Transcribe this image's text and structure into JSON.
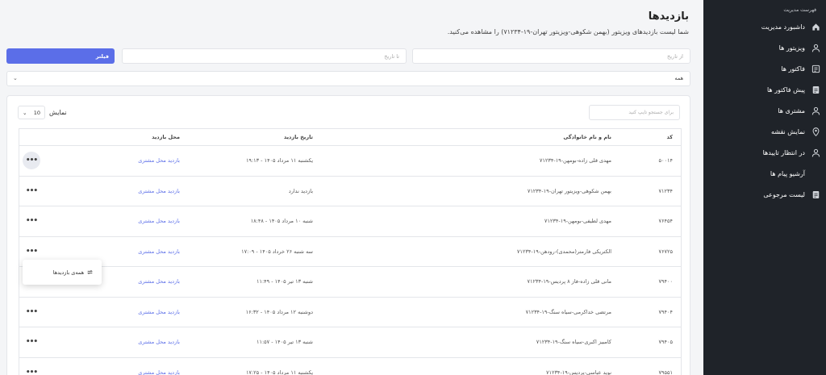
{
  "sidebar": {
    "header": "فهرست مدیریت",
    "items": [
      {
        "label": "داشبورد مدیریت",
        "icon": "home-icon"
      },
      {
        "label": "ویزیتور ها",
        "icon": "user-icon"
      },
      {
        "label": "فاکتور ها",
        "icon": "invoice-icon"
      },
      {
        "label": "پیش فاکتور ها",
        "icon": "document-icon"
      },
      {
        "label": "مشتری ها",
        "icon": "user-icon"
      },
      {
        "label": "نمایش نقشه",
        "icon": "map-pin-icon"
      },
      {
        "label": "در انتظار تاییدها",
        "icon": "user-icon"
      },
      {
        "label": "آرشیو پیام ها",
        "icon": ""
      },
      {
        "label": "لیست مرجوعی",
        "icon": "document-icon"
      }
    ]
  },
  "page": {
    "title": "بازدیدها",
    "subtitle": "شما لیست بازدیدهای ویزیتور (بهمن شکوهی-ویزیتور تهران-۱۹-۷۱۲۳۴) را مشاهده می‌کنید."
  },
  "filters": {
    "from_placeholder": "از تاریخ",
    "to_placeholder": "تا تاریخ",
    "filter_button": "فیلتر",
    "select_value": "همه"
  },
  "table": {
    "show_label": "نمایش",
    "page_size": "10",
    "search_placeholder": "برای جستجو تایپ کنید",
    "columns": [
      "کد",
      "نام و نام خانوادگی",
      "تاریخ بازدید",
      "محل بازدید"
    ],
    "rows": [
      {
        "code": "۵۰۰۱۴",
        "name": "مهدی قلی زاده-بومهن-۱۹-۷۱۲۳۴",
        "date": "یکشنبه ۱۱ مرداد ۱۴۰۵ - ۱۹:۱۳",
        "place": "بازدید محل مشتری"
      },
      {
        "code": "۷۱۲۳۴",
        "name": "بهمن شکوهی-ویزیتور تهران-۱۹-۷۱۲۳۴",
        "date": "بازدید ندارد",
        "place": "بازدید محل مشتری"
      },
      {
        "code": "۷۶۴۵۴",
        "name": "مهدی لطیفی-بومهن-۱۹-۷۱۲۳۴",
        "date": "شنبه ۱۰ مرداد ۱۴۰۵ - ۱۸:۴۸",
        "place": "بازدید محل مشتری"
      },
      {
        "code": "۷۶۷۲۵",
        "name": "الکتریکی فارمتر(محمدی)-رودهن-۱۹-۷۱۲۳۴",
        "date": "سه شنبه ۲۶ خرداد ۱۴۰۵ - ۱۷:۰۹",
        "place": "بازدید محل مشتری"
      },
      {
        "code": "۷۹۴۰۰",
        "name": "مانی قلی زاده-فاز ۸ پردیس-۱۹-۷۱۲۳۴",
        "date": "شنبه ۱۳ تیر ۱۴۰۵ - ۱۱:۴۹",
        "place": "بازدید محل مشتری"
      },
      {
        "code": "۷۹۴۰۴",
        "name": "مرتضی خداکرمی-سیاه سنگ-۱۹-۷۱۲۳۴",
        "date": "دوشنبه ۱۲ مرداد ۱۴۰۵ - ۱۶:۳۲",
        "place": "بازدید محل مشتری"
      },
      {
        "code": "۷۹۴۰۵",
        "name": "کامبیز اکبری-سیاه سنگ-۱۹-۷۱۲۳۴",
        "date": "شنبه ۱۳ تیر ۱۴۰۵ - ۱۱:۵۷",
        "place": "بازدید محل مشتری"
      },
      {
        "code": "۷۹۵۵۱",
        "name": "نوید عباسی-پردیس-۱۹-۷۱۲۳۴",
        "date": "یکشنبه ۱۱ مرداد ۱۴۰۵ - ۱۷:۲۵",
        "place": "بازدید محل مشتری"
      }
    ],
    "row_menu_label": "همه‌ی بازدیدها"
  },
  "colors": {
    "accent": "#5b6ee8",
    "sidebar_bg": "#1f2329"
  }
}
